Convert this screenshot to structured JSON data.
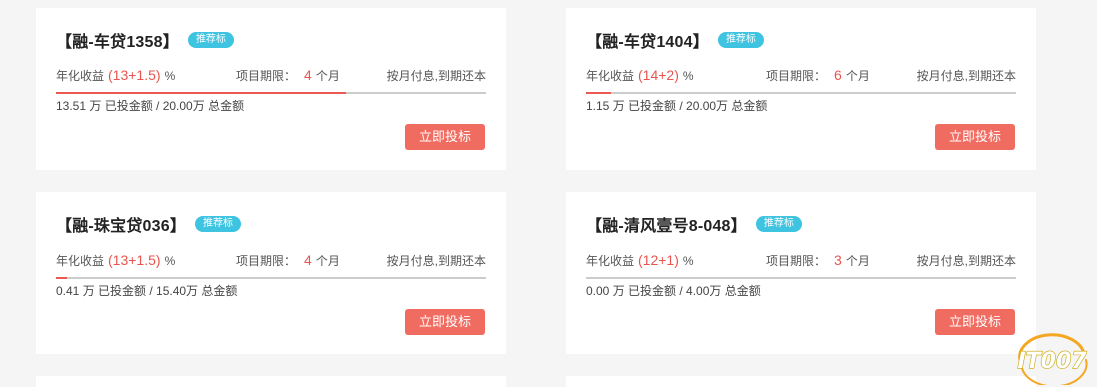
{
  "cards": [
    {
      "title": "【融-车贷1358】",
      "badge": "推荐标",
      "rate_label": "年化收益",
      "rate": "(13+1.5)",
      "pct": "%",
      "term_label": "项目期限：",
      "term": "4",
      "term_unit": "个月",
      "repay": "按月付息,到期还本",
      "progress": 0.6755,
      "amounts": "13.51 万  已投金额 / 20.00万  总金额",
      "button": "立即投标"
    },
    {
      "title": "【融-车贷1404】",
      "badge": "推荐标",
      "rate_label": "年化收益",
      "rate": "(14+2)",
      "pct": "%",
      "term_label": "项目期限：",
      "term": "6",
      "term_unit": "个月",
      "repay": "按月付息,到期还本",
      "progress": 0.0575,
      "amounts": "1.15 万  已投金额 / 20.00万  总金额",
      "button": "立即投标"
    },
    {
      "title": "【融-珠宝贷036】",
      "badge": "推荐标",
      "rate_label": "年化收益",
      "rate": "(13+1.5)",
      "pct": "%",
      "term_label": "项目期限：",
      "term": "4",
      "term_unit": "个月",
      "repay": "按月付息,到期还本",
      "progress": 0.0266,
      "amounts": "0.41 万  已投金额 / 15.40万  总金额",
      "button": "立即投标"
    },
    {
      "title": "【融-清风壹号8-048】",
      "badge": "推荐标",
      "rate_label": "年化收益",
      "rate": "(12+1)",
      "pct": "%",
      "term_label": "项目期限：",
      "term": "3",
      "term_unit": "个月",
      "repay": "按月付息,到期还本",
      "progress": 0.0,
      "amounts": "0.00 万  已投金额 / 4.00万  总金额",
      "button": "立即投标"
    }
  ],
  "watermark": "IT007",
  "colors": {
    "accent": "#f06b60",
    "badge": "#3ec3e0",
    "rate": "#e8554e"
  }
}
